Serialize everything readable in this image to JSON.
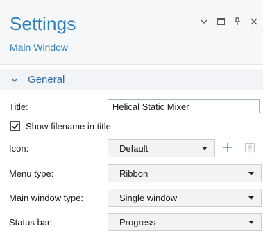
{
  "panel": {
    "title": "Settings",
    "subtitle": "Main Window"
  },
  "section": {
    "label": "General",
    "expanded": true
  },
  "fields": {
    "title_label": "Title:",
    "title_value": "Helical Static Mixer",
    "show_filename_label": "Show filename in title",
    "show_filename_checked": true,
    "icon_label": "Icon:",
    "icon_value": "Default",
    "menu_type_label": "Menu type:",
    "menu_type_value": "Ribbon",
    "main_window_type_label": "Main window type:",
    "main_window_type_value": "Single window",
    "status_bar_label": "Status bar:",
    "status_bar_value": "Progress"
  },
  "colors": {
    "accent": "#2d7fbf",
    "section_text": "#2f6ea6",
    "header_bg": "#f7f8fa"
  },
  "icons": [
    "chevron-down-icon",
    "maximize-icon",
    "pin-icon",
    "close-icon",
    "add-icon",
    "import-icon",
    "checkmark-icon"
  ]
}
